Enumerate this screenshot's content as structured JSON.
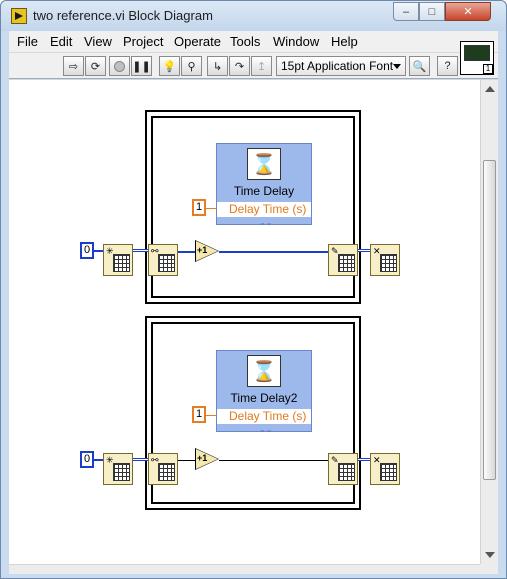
{
  "window": {
    "title": "two reference.vi Block Diagram",
    "minimize_glyph": "–",
    "maximize_glyph": "□",
    "close_glyph": "✕"
  },
  "menu": [
    "File",
    "Edit",
    "View",
    "Project",
    "Operate",
    "Tools",
    "Window",
    "Help"
  ],
  "toolbar": {
    "font_selector": "15pt Application Font",
    "buttons": [
      "run-arrow-icon",
      "run-continuously-icon",
      "abort-icon",
      "pause-icon",
      "highlight-execution-icon",
      "retain-wire-values-icon",
      "step-into-icon",
      "step-over-icon",
      "step-out-icon",
      "search-icon",
      "help-icon"
    ]
  },
  "vi_icon": {
    "connector_label": "1"
  },
  "diagram": {
    "frames": [
      {
        "delay_label": "Time Delay",
        "param_label": "Delay Time (s)",
        "delay_constant": "1",
        "shift_constant": "0",
        "increment_label": "+1"
      },
      {
        "delay_label": "Time Delay2",
        "param_label": "Delay Time (s)",
        "delay_constant": "1",
        "shift_constant": "0",
        "increment_label": "+1"
      }
    ]
  },
  "colors": {
    "wire_numeric": "#1a3ec8",
    "wire_orange": "#e87c20",
    "express_vi_fill": "#9db9ec",
    "window_frame": "#c9dbee"
  }
}
